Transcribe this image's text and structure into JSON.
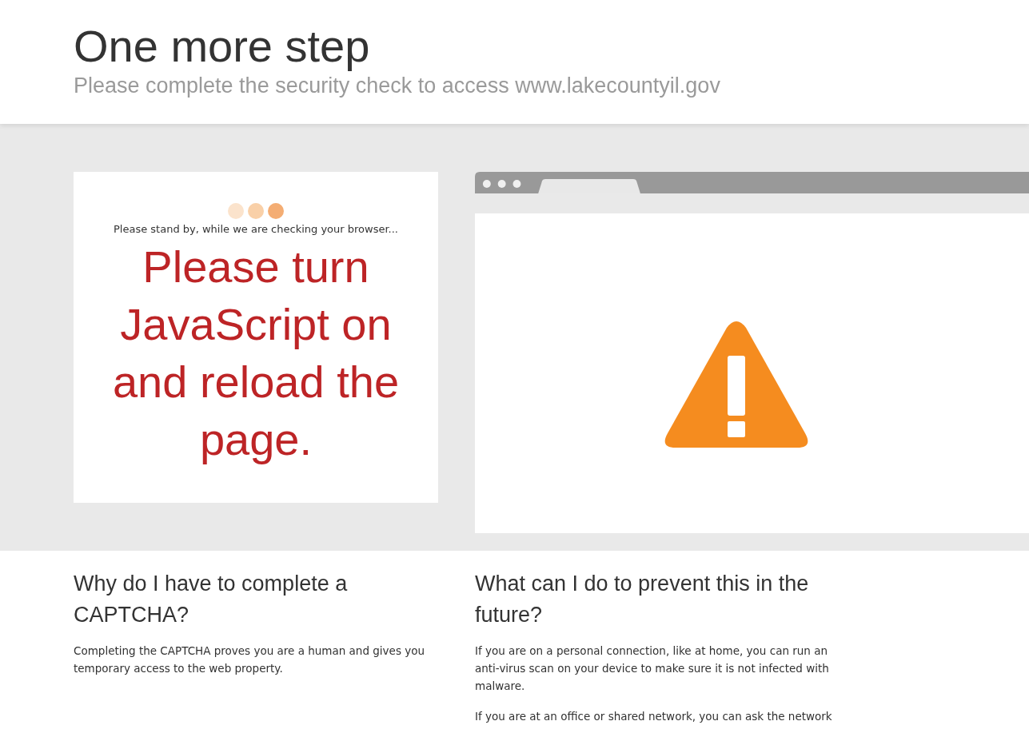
{
  "header": {
    "title": "One more step",
    "subtitle": "Please complete the security check to access www.lakecountyil.gov"
  },
  "check_card": {
    "status": "Please stand by, while we are checking your browser...",
    "warning": "Please turn JavaScript on and reload the page."
  },
  "sections": [
    {
      "heading": "Why do I have to complete a CAPTCHA?",
      "paragraphs": [
        "Completing the CAPTCHA proves you are a human and gives you temporary access to the web property."
      ]
    },
    {
      "heading": "What can I do to prevent this in the future?",
      "paragraphs": [
        "If you are on a personal connection, like at home, you can run an anti-virus scan on your device to make sure it is not infected with malware.",
        "If you are at an office or shared network, you can ask the network"
      ]
    }
  ]
}
